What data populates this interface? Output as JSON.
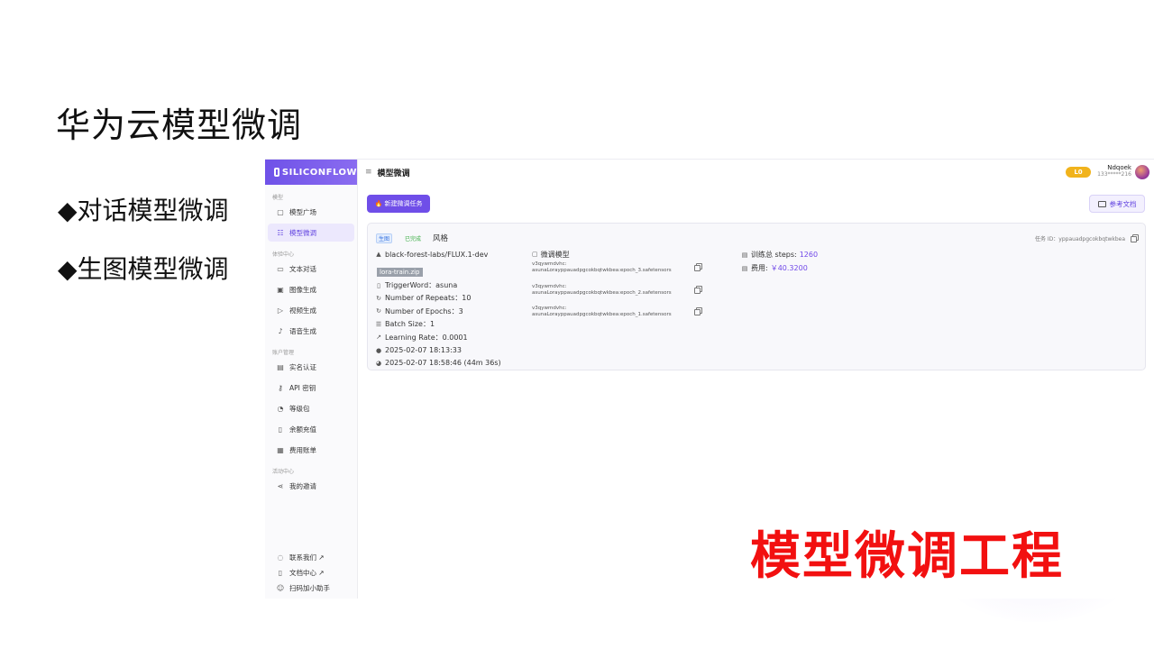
{
  "slide": {
    "title": "华为云模型微调",
    "bullets": [
      "◆对话模型微调",
      "◆生图模型微调"
    ],
    "caption": "模型微调工程"
  },
  "app": {
    "brand": "SILICONFLOW",
    "sidebar": {
      "sections": [
        {
          "label": "模型",
          "items": [
            {
              "label": "模型广场",
              "icon": "cube-icon"
            },
            {
              "label": "模型微调",
              "icon": "sliders-icon",
              "active": true
            }
          ]
        },
        {
          "label": "体验中心",
          "items": [
            {
              "label": "文本对话",
              "icon": "chat-icon"
            },
            {
              "label": "图像生成",
              "icon": "image-icon"
            },
            {
              "label": "视频生成",
              "icon": "video-icon"
            },
            {
              "label": "语音生成",
              "icon": "mic-icon"
            }
          ]
        },
        {
          "label": "账户管理",
          "items": [
            {
              "label": "实名认证",
              "icon": "id-card-icon"
            },
            {
              "label": "API 密钥",
              "icon": "key-icon"
            },
            {
              "label": "等级包",
              "icon": "gauge-icon"
            },
            {
              "label": "余额充值",
              "icon": "wallet-icon"
            },
            {
              "label": "费用账单",
              "icon": "bill-icon"
            }
          ]
        },
        {
          "label": "活动中心",
          "items": [
            {
              "label": "我的邀请",
              "icon": "share-icon"
            }
          ]
        }
      ],
      "bottom_links": [
        {
          "label": "联系我们 ↗",
          "icon": "help-icon"
        },
        {
          "label": "文档中心 ↗",
          "icon": "doc-icon"
        },
        {
          "label": "扫码加小助手",
          "icon": "users-icon"
        }
      ]
    },
    "topbar": {
      "page_title": "模型微调",
      "level": "L0",
      "user_name": "Ndqoek",
      "user_phone": "133*****216"
    },
    "new_task_button": "🔥 新建微调任务",
    "docs_button": "参考文档",
    "task": {
      "type_tag": "生图",
      "status_tag": "已完成",
      "style": "风格",
      "task_id": "任务 ID：yppauadpgcokbqtwkbea",
      "base_model": "black-forest-labs/FLUX.1-dev",
      "dataset": "lora-train.zip",
      "trigger_word": "TriggerWord：asuna",
      "repeats": "Number of Repeats：10",
      "epochs": "Number of Epochs：3",
      "batch_size": "Batch Size：1",
      "learning_rate": "Learning Rate：0.0001",
      "created_at": "2025-02-07 18:13:33",
      "finished_at": "2025-02-07 18:58:46 (44m 36s)",
      "models_header": "微调模型",
      "models": [
        {
          "line1": "v3qywmdvhc:",
          "line2": "asunaLorayppauadpgcokbqtwkbea:epoch_3.safetensors"
        },
        {
          "line1": "v3qywmdvhc:",
          "line2": "asunaLorayppauadpgcokbqtwkbea:epoch_2.safetensors"
        },
        {
          "line1": "v3qywmdvhc:",
          "line2": "asunaLorayppauadpgcokbqtwkbea:epoch_1.safetensors"
        }
      ],
      "steps_label": "训练总 steps:",
      "steps_value": "1260",
      "cost_label": "费用:",
      "cost_value": "￥40.3200"
    }
  }
}
